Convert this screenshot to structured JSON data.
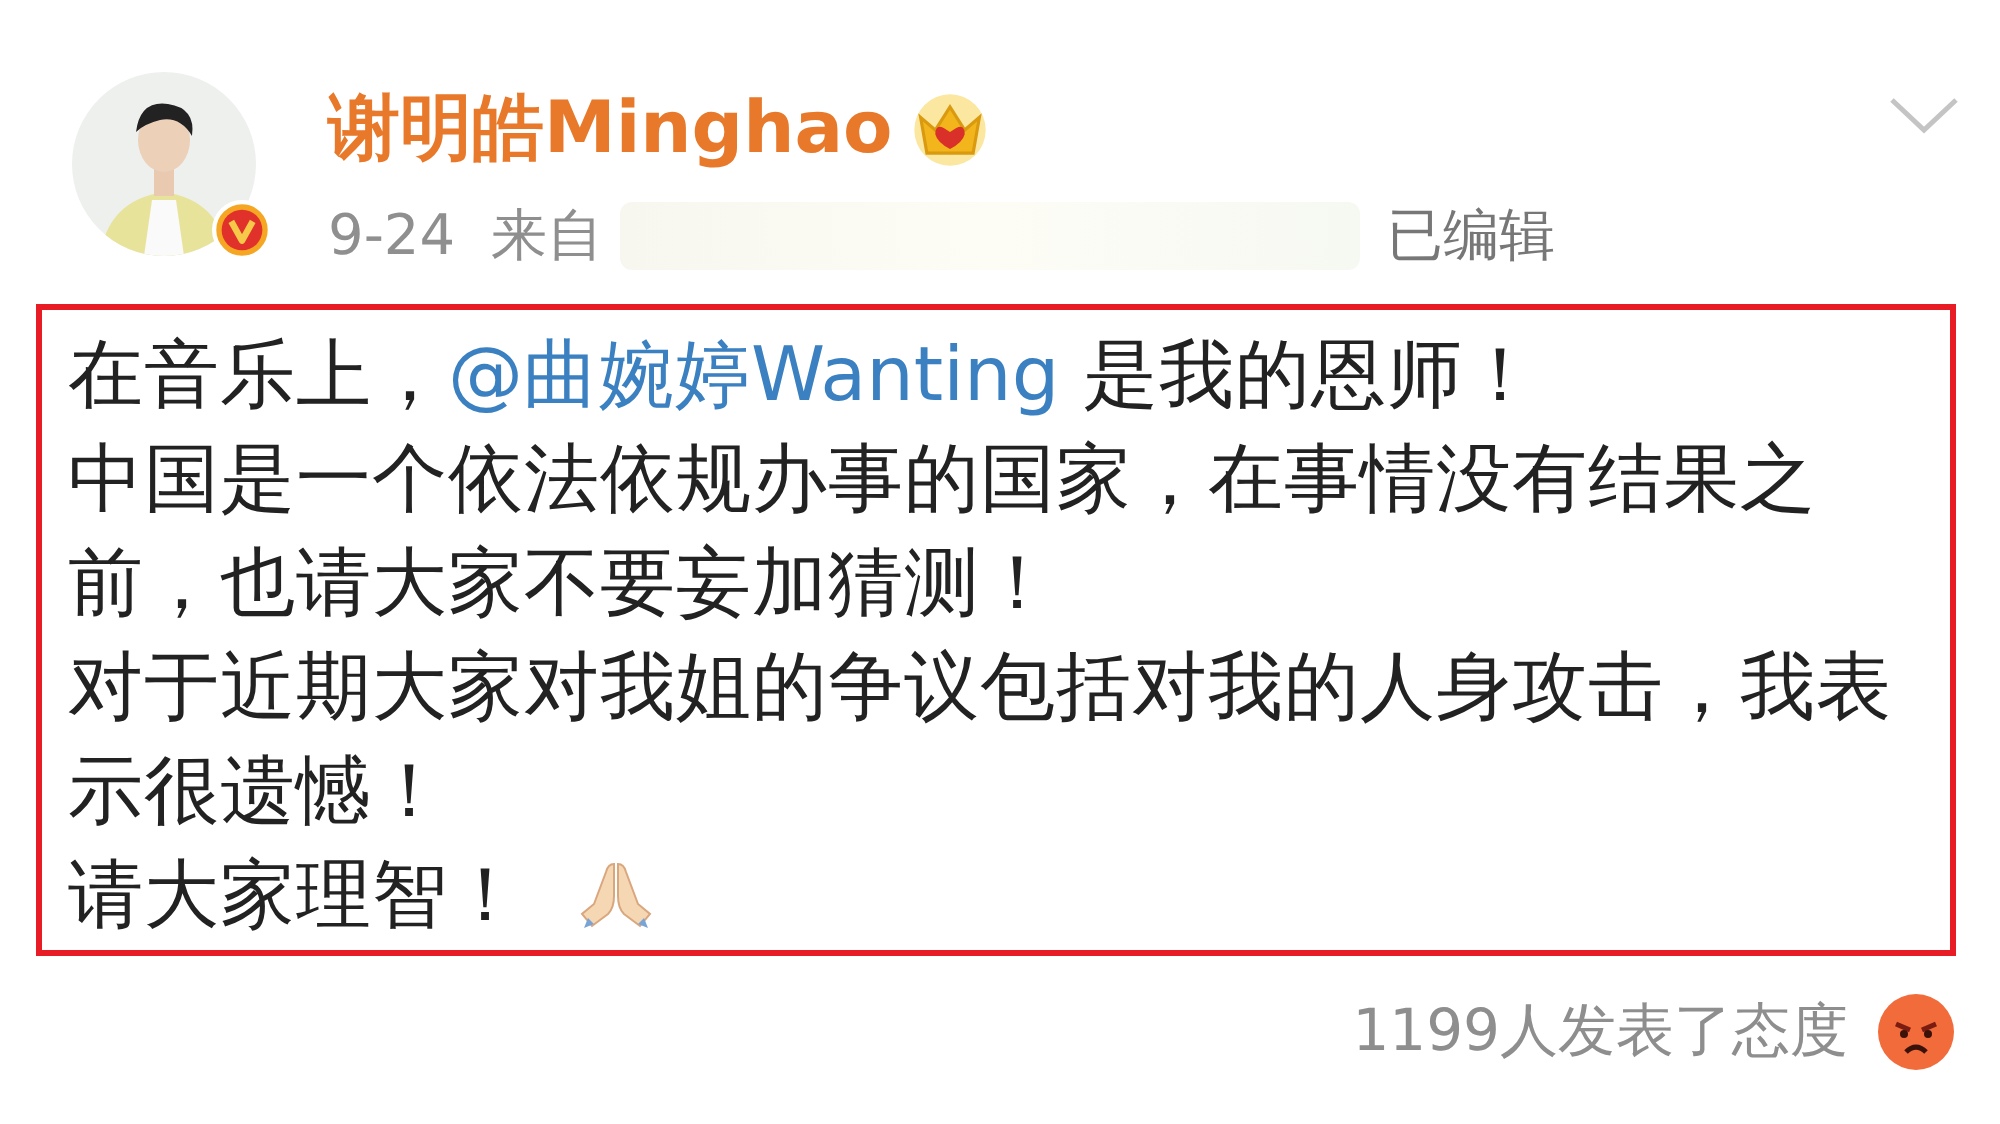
{
  "post": {
    "author": {
      "name": "谢明皓Minghao",
      "verified": true
    },
    "time": "9-24",
    "source_label": "来自",
    "edited": "已编辑",
    "highlighted": true,
    "paragraphs": [
      {
        "kind": "mention",
        "before": "在音乐上，",
        "mention": "@曲婉婷Wanting",
        "after": " 是我的恩师！"
      },
      {
        "kind": "plain",
        "before": "中国是一个依法依规办事的国家，在事情没有结果之前，也请大家不要妄加猜测！"
      },
      {
        "kind": "plain",
        "before": "对于近期大家对我姐的争议包括对我的人身攻击，我表示很遗憾！"
      },
      {
        "kind": "icon",
        "before": "请大家理智！"
      }
    ],
    "reactions": {
      "text": "1199人发表了态度"
    }
  }
}
